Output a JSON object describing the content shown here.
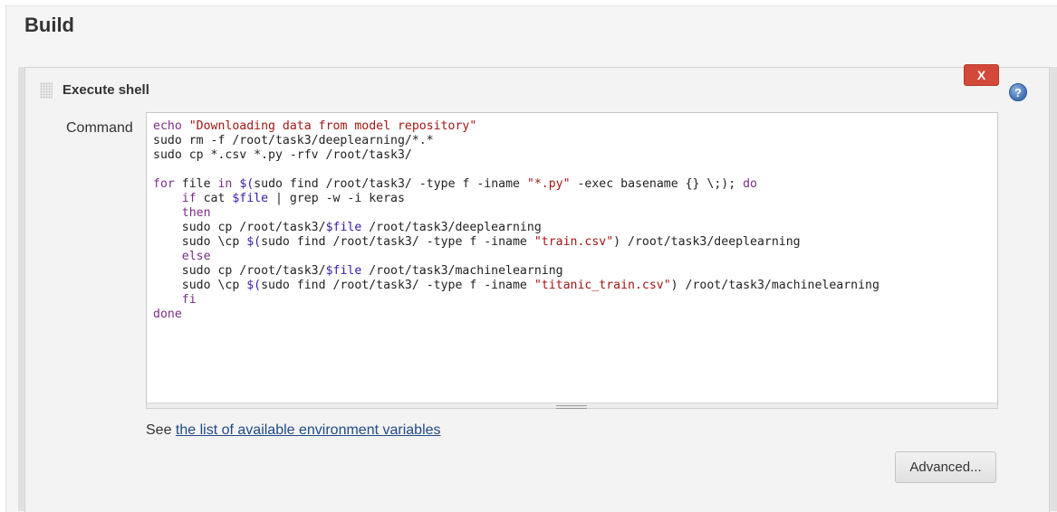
{
  "section": {
    "title": "Build"
  },
  "step": {
    "title": "Execute shell",
    "delete_label": "X",
    "help_glyph": "?",
    "icons": {
      "drag": "drag-handle-icon",
      "help": "help-icon"
    },
    "colors": {
      "delete": "#d24939",
      "help": "#3f6fb3",
      "link": "#204a87"
    }
  },
  "command": {
    "label": "Command",
    "lines": [
      "echo \"Downloading data from model repository\"",
      "sudo rm -f /root/task3/deeplearning/*.*",
      "sudo cp *.csv *.py -rfv /root/task3/",
      "",
      "for file in $(sudo find /root/task3/ -type f -iname \"*.py\" -exec basename {} \\;); do",
      "    if cat $file | grep -w -i keras",
      "    then",
      "    sudo cp /root/task3/$file /root/task3/deeplearning",
      "    sudo \\cp $(sudo find /root/task3/ -type f -iname \"train.csv\") /root/task3/deeplearning",
      "    else",
      "    sudo cp /root/task3/$file /root/task3/machinelearning",
      "    sudo \\cp $(sudo find /root/task3/ -type f -iname \"titanic_train.csv\") /root/task3/machinelearning",
      "    fi",
      "done"
    ]
  },
  "env_help": {
    "prefix": "See",
    "link_text": "the list of available environment variables"
  },
  "advanced": {
    "label": "Advanced..."
  }
}
